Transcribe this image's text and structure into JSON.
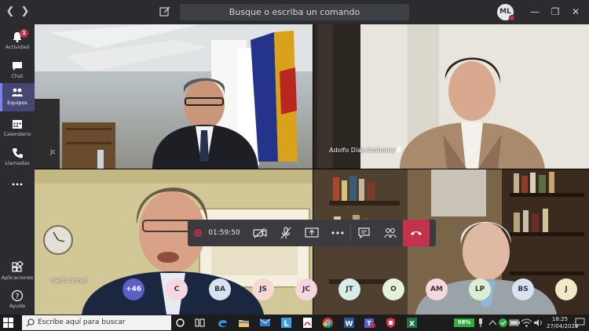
{
  "titlebar": {
    "search_placeholder": "Busque o escriba un comando",
    "me_initials": "ML"
  },
  "rail": {
    "items": [
      {
        "label": "Actividad",
        "icon": "bell-icon",
        "badge": "1"
      },
      {
        "label": "Chat",
        "icon": "chat-icon"
      },
      {
        "label": "Equipos",
        "icon": "teams-icon"
      },
      {
        "label": "Calendario",
        "icon": "calendar-icon"
      },
      {
        "label": "Llamadas",
        "icon": "phone-icon"
      },
      {
        "label": "",
        "icon": "more-icon"
      },
      {
        "label": "Aplicaciones",
        "icon": "apps-icon"
      },
      {
        "label": "Ayuda",
        "icon": "help-icon"
      }
    ],
    "active_label": "Equipos"
  },
  "participants": [
    {
      "name": "jc"
    },
    {
      "name": "Adolfo Díaz-Ambrona",
      "muted": true
    },
    {
      "name": "daldo bonet"
    },
    {
      "name": ""
    }
  ],
  "controls": {
    "timer": "01:59:50"
  },
  "avatars": [
    {
      "initials": "+46",
      "color": "#5b5fc7",
      "text_color": "#ffffff"
    },
    {
      "initials": "C",
      "color": "#f4d7df"
    },
    {
      "initials": "BA",
      "color": "#d7e3f3"
    },
    {
      "initials": "JS",
      "color": "#f6d9d4"
    },
    {
      "initials": "JC",
      "color": "#f4d7df"
    },
    {
      "initials": "JT",
      "color": "#d6ede9"
    },
    {
      "initials": "O",
      "color": "#e5f1d9"
    },
    {
      "initials": "AM",
      "color": "#f4d7df"
    },
    {
      "initials": "LP",
      "color": "#dbeed4"
    },
    {
      "initials": "BS",
      "color": "#d7e3f3"
    },
    {
      "initials": "J",
      "color": "#f1e8c8"
    }
  ],
  "taskbar": {
    "search_placeholder": "Escribe aquí para buscar",
    "battery": "98%",
    "time": "18:25",
    "date": "27/04/2020"
  },
  "colors": {
    "accent": "#464775",
    "hangup": "#c4314b",
    "recording": "#c4314b"
  }
}
